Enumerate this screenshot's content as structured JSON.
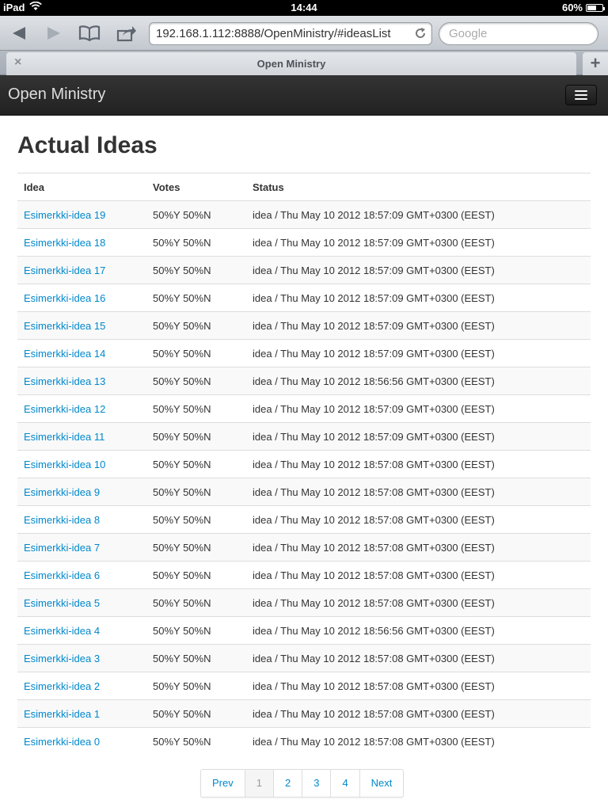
{
  "status_bar": {
    "device": "iPad",
    "time": "14:44",
    "battery": "60%",
    "battery_level": 0.6
  },
  "browser": {
    "url": "192.168.1.112:8888/OpenMinistry/#ideasList",
    "search_placeholder": "Google",
    "tab_title": "Open Ministry"
  },
  "navbar": {
    "brand": "Open Ministry"
  },
  "page": {
    "title": "Actual Ideas",
    "columns": [
      "Idea",
      "Votes",
      "Status"
    ],
    "rows": [
      {
        "idea": "Esimerkki-idea 19",
        "votes": "50%Y 50%N",
        "status": "idea / Thu May 10 2012 18:57:09 GMT+0300 (EEST)"
      },
      {
        "idea": "Esimerkki-idea 18",
        "votes": "50%Y 50%N",
        "status": "idea / Thu May 10 2012 18:57:09 GMT+0300 (EEST)"
      },
      {
        "idea": "Esimerkki-idea 17",
        "votes": "50%Y 50%N",
        "status": "idea / Thu May 10 2012 18:57:09 GMT+0300 (EEST)"
      },
      {
        "idea": "Esimerkki-idea 16",
        "votes": "50%Y 50%N",
        "status": "idea / Thu May 10 2012 18:57:09 GMT+0300 (EEST)"
      },
      {
        "idea": "Esimerkki-idea 15",
        "votes": "50%Y 50%N",
        "status": "idea / Thu May 10 2012 18:57:09 GMT+0300 (EEST)"
      },
      {
        "idea": "Esimerkki-idea 14",
        "votes": "50%Y 50%N",
        "status": "idea / Thu May 10 2012 18:57:09 GMT+0300 (EEST)"
      },
      {
        "idea": "Esimerkki-idea 13",
        "votes": "50%Y 50%N",
        "status": "idea / Thu May 10 2012 18:56:56 GMT+0300 (EEST)"
      },
      {
        "idea": "Esimerkki-idea 12",
        "votes": "50%Y 50%N",
        "status": "idea / Thu May 10 2012 18:57:09 GMT+0300 (EEST)"
      },
      {
        "idea": "Esimerkki-idea 11",
        "votes": "50%Y 50%N",
        "status": "idea / Thu May 10 2012 18:57:09 GMT+0300 (EEST)"
      },
      {
        "idea": "Esimerkki-idea 10",
        "votes": "50%Y 50%N",
        "status": "idea / Thu May 10 2012 18:57:08 GMT+0300 (EEST)"
      },
      {
        "idea": "Esimerkki-idea 9",
        "votes": "50%Y 50%N",
        "status": "idea / Thu May 10 2012 18:57:08 GMT+0300 (EEST)"
      },
      {
        "idea": "Esimerkki-idea 8",
        "votes": "50%Y 50%N",
        "status": "idea / Thu May 10 2012 18:57:08 GMT+0300 (EEST)"
      },
      {
        "idea": "Esimerkki-idea 7",
        "votes": "50%Y 50%N",
        "status": "idea / Thu May 10 2012 18:57:08 GMT+0300 (EEST)"
      },
      {
        "idea": "Esimerkki-idea 6",
        "votes": "50%Y 50%N",
        "status": "idea / Thu May 10 2012 18:57:08 GMT+0300 (EEST)"
      },
      {
        "idea": "Esimerkki-idea 5",
        "votes": "50%Y 50%N",
        "status": "idea / Thu May 10 2012 18:57:08 GMT+0300 (EEST)"
      },
      {
        "idea": "Esimerkki-idea 4",
        "votes": "50%Y 50%N",
        "status": "idea / Thu May 10 2012 18:56:56 GMT+0300 (EEST)"
      },
      {
        "idea": "Esimerkki-idea 3",
        "votes": "50%Y 50%N",
        "status": "idea / Thu May 10 2012 18:57:08 GMT+0300 (EEST)"
      },
      {
        "idea": "Esimerkki-idea 2",
        "votes": "50%Y 50%N",
        "status": "idea / Thu May 10 2012 18:57:08 GMT+0300 (EEST)"
      },
      {
        "idea": "Esimerkki-idea 1",
        "votes": "50%Y 50%N",
        "status": "idea / Thu May 10 2012 18:57:08 GMT+0300 (EEST)"
      },
      {
        "idea": "Esimerkki-idea 0",
        "votes": "50%Y 50%N",
        "status": "idea / Thu May 10 2012 18:57:08 GMT+0300 (EEST)"
      }
    ]
  },
  "pagination": {
    "prev": "Prev",
    "pages": [
      "1",
      "2",
      "3",
      "4"
    ],
    "active_page": "1",
    "next": "Next"
  },
  "colors": {
    "link": "#0088cc",
    "navbar": "#222222"
  }
}
